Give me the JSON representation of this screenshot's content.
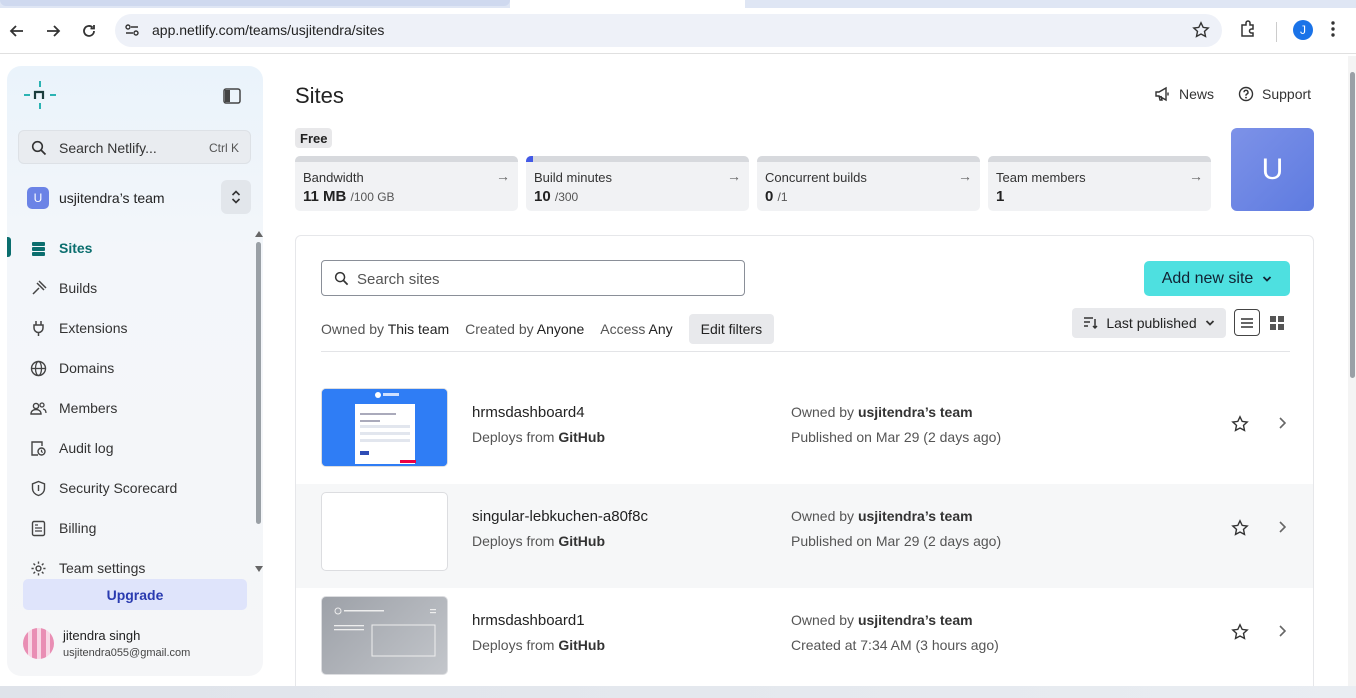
{
  "browser": {
    "url": "app.netlify.com/teams/usjitendra/sites",
    "profile_initial": "J"
  },
  "sidebar": {
    "search_placeholder": "Search Netlify...",
    "search_shortcut": "Ctrl K",
    "team_initial": "U",
    "team_name": "usjitendra’s team",
    "items": [
      {
        "label": "Sites",
        "icon": "sites-icon",
        "active": true
      },
      {
        "label": "Builds",
        "icon": "builds-icon"
      },
      {
        "label": "Extensions",
        "icon": "extensions-icon"
      },
      {
        "label": "Domains",
        "icon": "globe-icon"
      },
      {
        "label": "Members",
        "icon": "members-icon"
      },
      {
        "label": "Audit log",
        "icon": "audit-log-icon"
      },
      {
        "label": "Security Scorecard",
        "icon": "shield-icon"
      },
      {
        "label": "Billing",
        "icon": "billing-icon"
      },
      {
        "label": "Team settings",
        "icon": "gear-icon"
      }
    ],
    "upgrade_label": "Upgrade",
    "user_name": "jitendra singh",
    "user_email": "usjitendra055@gmail.com"
  },
  "header": {
    "title": "Sites",
    "news_label": "News",
    "support_label": "Support",
    "plan": "Free",
    "avatar_initial": "U"
  },
  "usage": [
    {
      "name": "Bandwidth",
      "value": "11 MB",
      "limit": "/100 GB",
      "fill": 0.0
    },
    {
      "name": "Build minutes",
      "value": "10",
      "limit": "/300",
      "fill": 0.033
    },
    {
      "name": "Concurrent builds",
      "value": "0",
      "limit": "/1",
      "fill": 0.0
    },
    {
      "name": "Team members",
      "value": "1",
      "limit": "",
      "fill": 0.0
    }
  ],
  "sites_panel": {
    "search_placeholder": "Search sites",
    "add_button": "Add new site",
    "filters": {
      "owned_label": "Owned by",
      "owned_value": "This team",
      "created_label": "Created by",
      "created_value": "Anyone",
      "access_label": "Access",
      "access_value": "Any",
      "edit_label": "Edit filters"
    },
    "sort_label": "Last published",
    "sites": [
      {
        "name": "hrmsdashboard4",
        "deploy_prefix": "Deploys from",
        "deploy_source": "GitHub",
        "owner_prefix": "Owned by",
        "owner": "usjitendra’s team",
        "date": "Published on Mar 29 (2 days ago)"
      },
      {
        "name": "singular-lebkuchen-a80f8c",
        "deploy_prefix": "Deploys from",
        "deploy_source": "GitHub",
        "owner_prefix": "Owned by",
        "owner": "usjitendra’s team",
        "date": "Published on Mar 29 (2 days ago)"
      },
      {
        "name": "hrmsdashboard1",
        "deploy_prefix": "Deploys from",
        "deploy_source": "GitHub",
        "owner_prefix": "Owned by",
        "owner": "usjitendra’s team",
        "date": "Created at 7:34 AM (3 hours ago)"
      }
    ]
  }
}
